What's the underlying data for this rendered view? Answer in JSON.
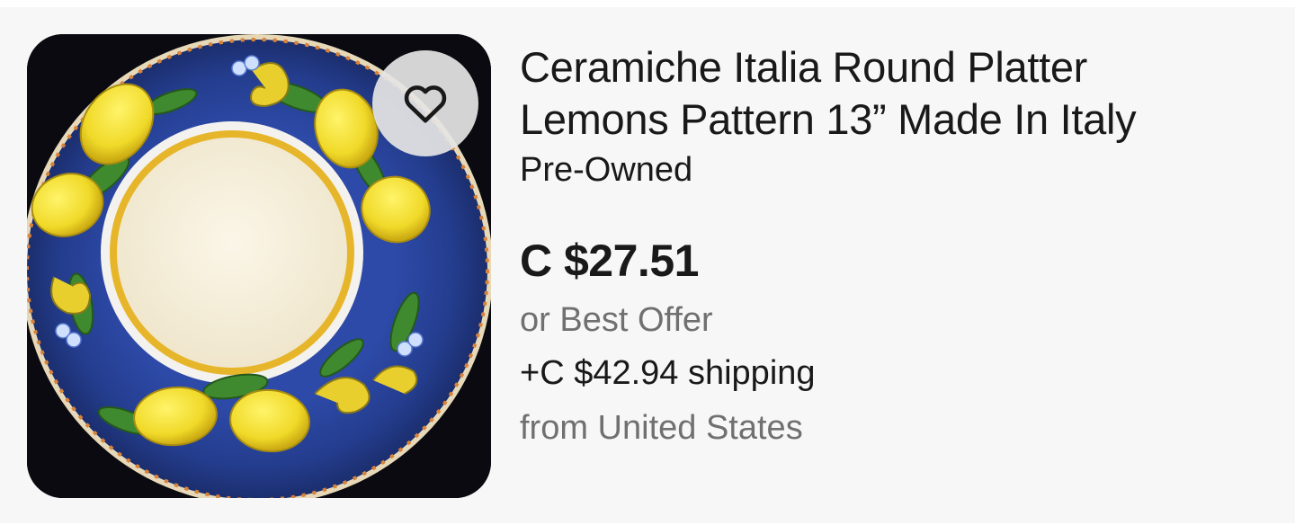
{
  "listing": {
    "title_line1": "Ceramiche Italia Round Platter",
    "title_line2": "Lemons Pattern 13” Made In Italy",
    "condition": "Pre-Owned",
    "price": "C $27.51",
    "offer": "or Best Offer",
    "shipping": "+C $42.94 shipping",
    "location": "from United States",
    "image_alt": "Ceramiche Italia Round Platter Lemons Pattern 13” Made In Italy"
  },
  "watch": {
    "icon": "heart-outline-icon",
    "label": "Watch"
  },
  "colors": {
    "card_bg": "#f7f7f7",
    "text_primary": "#191919",
    "text_secondary": "#707070",
    "plate_rim": "#2f48a0",
    "lemon": "#f2e13a",
    "leaf": "#3f8a2f"
  }
}
